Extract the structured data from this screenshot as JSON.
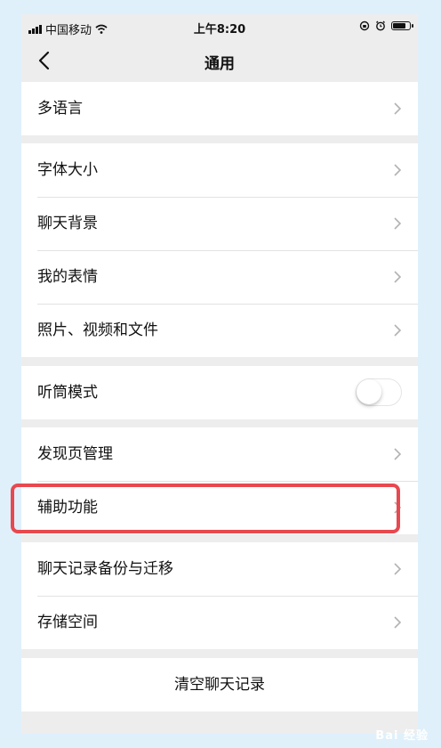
{
  "status": {
    "carrier": "中国移动",
    "time": "上午8:20"
  },
  "nav": {
    "title": "通用"
  },
  "groups": [
    {
      "items": [
        {
          "label": "多语言"
        }
      ]
    },
    {
      "items": [
        {
          "label": "字体大小"
        },
        {
          "label": "聊天背景"
        },
        {
          "label": "我的表情"
        },
        {
          "label": "照片、视频和文件"
        }
      ]
    },
    {
      "items": [
        {
          "label": "听筒模式",
          "toggle": false
        }
      ]
    },
    {
      "items": [
        {
          "label": "发现页管理"
        },
        {
          "label": "辅助功能"
        }
      ]
    },
    {
      "items": [
        {
          "label": "聊天记录备份与迁移"
        },
        {
          "label": "存储空间"
        }
      ]
    }
  ],
  "clear_history": {
    "label": "清空聊天记录"
  },
  "watermark": {
    "text": "Bai 经验"
  },
  "colors": {
    "background": "#ededed",
    "highlight": "#e8484f",
    "outer": "#dff0fb"
  }
}
